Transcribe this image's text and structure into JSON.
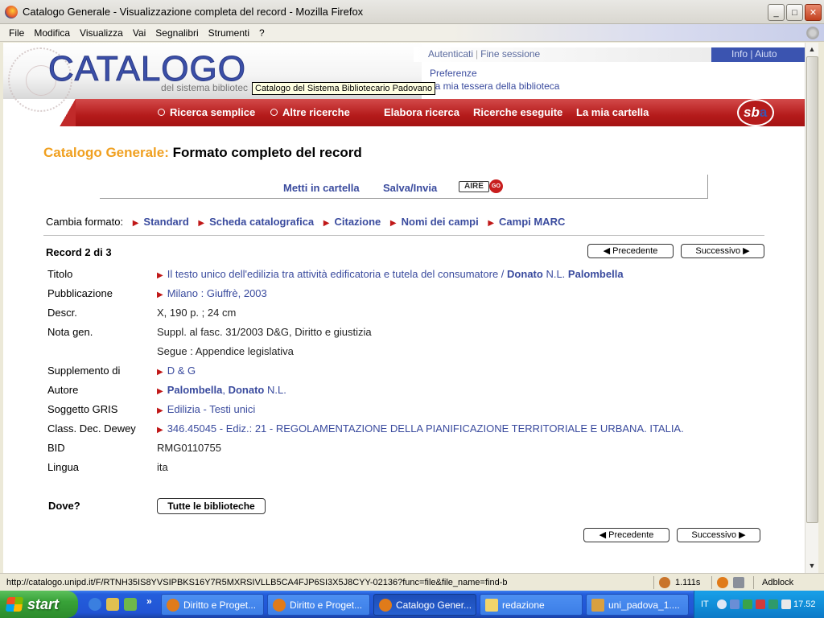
{
  "window": {
    "title": "Catalogo Generale - Visualizzazione completa del record - Mozilla Firefox",
    "buttons": {
      "minimize": "_",
      "maximize": "□",
      "close": "✕"
    }
  },
  "menu": [
    "File",
    "Modifica",
    "Visualizza",
    "Vai",
    "Segnalibri",
    "Strumenti",
    "?"
  ],
  "header": {
    "logo": "CATALOGO",
    "logo_sub": "del sistema bibliotec",
    "tooltip": "Catalogo del Sistema Bibliotecario Padovano",
    "top_links": [
      "Autenticati",
      "Fine sessione"
    ],
    "info_links": "Info | Aiuto",
    "preferences": "Preferenze",
    "tessera": "La mia tessera della biblioteca",
    "nav": [
      "Ricerca semplice",
      "Altre ricerche",
      "Elabora ricerca",
      "Ricerche eseguite",
      "La mia cartella"
    ],
    "brand": {
      "s": "s",
      "b": "b",
      "a": "a"
    }
  },
  "page": {
    "title_accent": "Catalogo Generale:",
    "title_main": "Formato completo del record",
    "actions": [
      "Metti in cartella",
      "Salva/Invia"
    ],
    "aire": "AIRE",
    "aire_go": "GO",
    "format_label": "Cambia formato:",
    "formats": [
      "Standard",
      "Scheda catalografica",
      "Citazione",
      "Nomi dei campi",
      "Campi MARC"
    ],
    "record_count": "Record 2 di 3",
    "prev": "◀ Precedente",
    "next": "Successivo ▶",
    "fields": {
      "titolo_lbl": "Titolo",
      "titolo_val": "Il testo unico dell'edilizia tra attività edificatoria e tutela del consumatore /",
      "titolo_auth_a": "Donato",
      "titolo_auth_b": "N.L.",
      "titolo_auth_c": "Palombella",
      "pubb_lbl": "Pubblicazione",
      "pubb_val": "Milano : Giuffrè, 2003",
      "descr_lbl": "Descr.",
      "descr_val": "X, 190 p. ; 24 cm",
      "nota_lbl": "Nota gen.",
      "nota_val1": "Suppl. al fasc. 31/2003 D&G, Diritto e giustizia",
      "nota_val2": "Segue : Appendice legislativa",
      "suppl_lbl": "Supplemento di",
      "suppl_val": "D & G",
      "autore_lbl": "Autore",
      "autore_a": "Palombella",
      "autore_comma": ",",
      "autore_b": "Donato",
      "autore_c": "N.L.",
      "sogg_lbl": "Soggetto GRIS",
      "sogg_val": "Edilizia - Testi unici",
      "class_lbl": "Class. Dec. Dewey",
      "class_val": "346.45045 - Ediz.: 21 - REGOLAMENTAZIONE DELLA PIANIFICAZIONE TERRITORIALE E URBANA. ITALIA.",
      "bid_lbl": "BID",
      "bid_val": "RMG0110755",
      "lingua_lbl": "Lingua",
      "lingua_val": "ita"
    },
    "dove_label": "Dove?",
    "tutte_button": "Tutte le biblioteche"
  },
  "statusbar": {
    "url": "http://catalogo.unipd.it/F/RTNH35IS8YVSIPBKS16Y7R5MXRSIVLLB5CA4FJP6SI3X5J8CYY-02136?func=file&file_name=find-b",
    "timer": "1.111s",
    "adblock": "Adblock"
  },
  "taskbar": {
    "start": "start",
    "more": "»",
    "tasks": [
      "Diritto e Proget...",
      "Diritto e Proget...",
      "Catalogo Gener...",
      "redazione",
      "uni_padova_1...."
    ],
    "lang": "IT",
    "clock": "17.52"
  }
}
